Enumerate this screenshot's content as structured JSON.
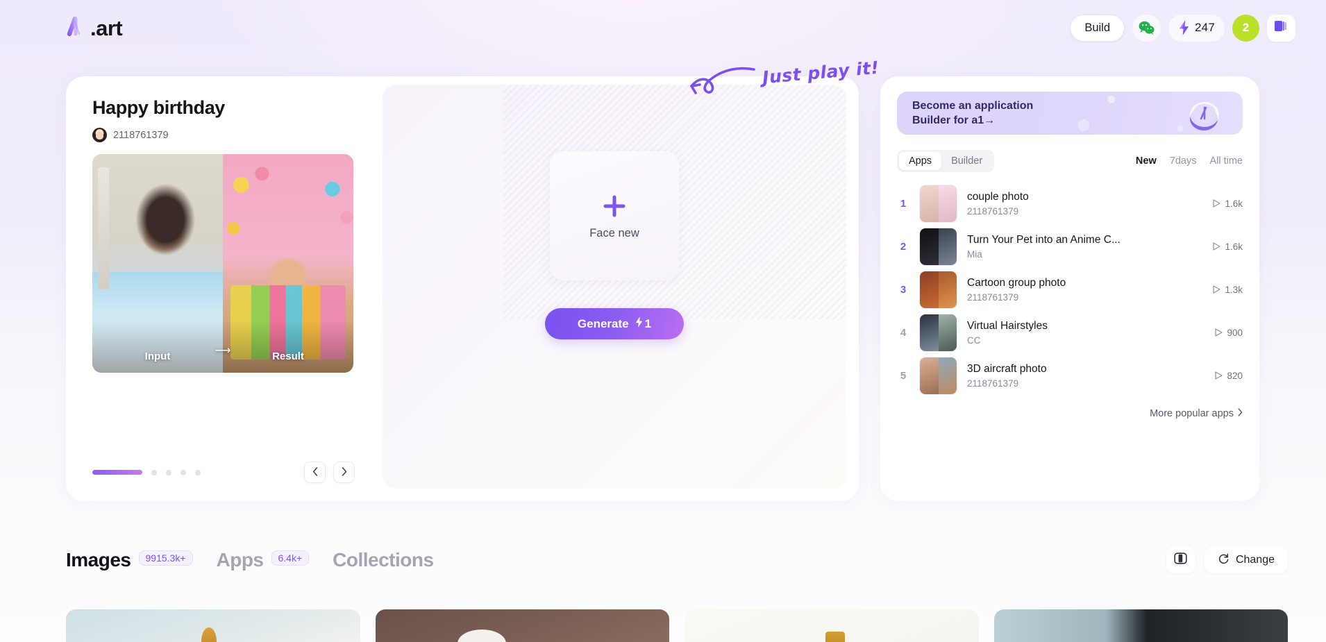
{
  "header": {
    "logo_text": ".art",
    "logo_icon": "a-logo-icon",
    "build_label": "Build",
    "wechat_icon": "wechat-icon",
    "credits_icon": "lightning-bolt-icon",
    "credits": "247",
    "avatar_badge": "2",
    "library_icon": "book-stack-icon"
  },
  "hero": {
    "title": "Happy birthday",
    "author": "2118761379",
    "before_label": "Input",
    "after_label": "Result",
    "arrow": "⟶",
    "carousel": {
      "total_dots": 5,
      "active_index": 0
    },
    "prev_icon": "chevron-left-icon",
    "next_icon": "chevron-right-icon",
    "face_new_label": "Face new",
    "plus_icon": "plus-icon",
    "generate_label": "Generate",
    "generate_cost": "1",
    "generate_cost_icon": "lightning-bolt-icon"
  },
  "annotation": {
    "text": "Just play it!",
    "arrow_icon": "hand-drawn-arrow-left-icon",
    "color": "#7c4ff0"
  },
  "right_panel": {
    "promo": {
      "text": "Become an application\nBuilder for a1→",
      "coin_icon": "a-coin-icon"
    },
    "segmented": [
      {
        "label": "Apps",
        "active": true
      },
      {
        "label": "Builder",
        "active": false
      }
    ],
    "filters": [
      {
        "label": "New",
        "active": true
      },
      {
        "label": "7days",
        "active": false
      },
      {
        "label": "All time",
        "active": false
      }
    ],
    "apps": [
      {
        "rank": "1",
        "name": "couple photo",
        "author": "2118761379",
        "plays": "1.6k",
        "c1": "#e8c4b8",
        "c2": "#f3d4de"
      },
      {
        "rank": "2",
        "name": "Turn Your Pet into an Anime C...",
        "author": "Mia",
        "plays": "1.6k",
        "c1": "#151518",
        "c2": "#3f4450"
      },
      {
        "rank": "3",
        "name": "Cartoon group photo",
        "author": "2118761379",
        "plays": "1.3k",
        "c1": "#7d3a22",
        "c2": "#b4562e"
      },
      {
        "rank": "4",
        "name": "Virtual Hairstyles",
        "author": "CC",
        "plays": "900",
        "c1": "#27303c",
        "c2": "#9fb3a6"
      },
      {
        "rank": "5",
        "name": "3D aircraft photo",
        "author": "2118761379",
        "plays": "820",
        "c1": "#c7a58c",
        "c2": "#8fa9bd"
      }
    ],
    "more_label": "More popular apps",
    "more_icon": "chevron-right-icon",
    "play_icon": "play-triangle-icon"
  },
  "bottom": {
    "tabs": [
      {
        "label": "Images",
        "badge": "9915.3k+",
        "active": true
      },
      {
        "label": "Apps",
        "badge": "6.4k+",
        "active": false
      },
      {
        "label": "Collections",
        "badge": "",
        "active": false
      }
    ],
    "layout_icon": "panel-layout-icon",
    "change_label": "Change",
    "change_icon": "refresh-icon",
    "gallery_count": 4
  }
}
